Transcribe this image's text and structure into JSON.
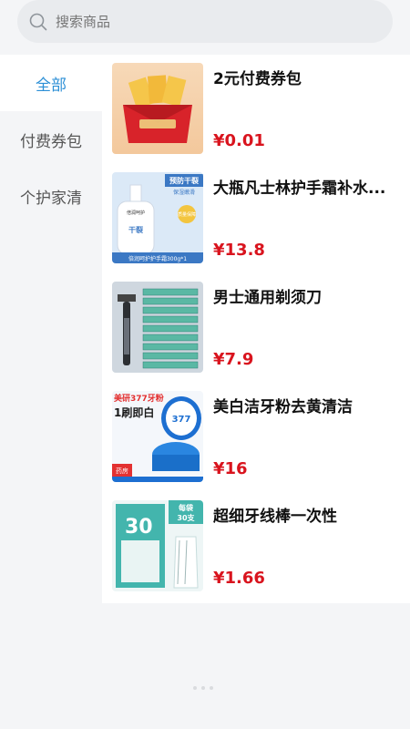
{
  "search": {
    "placeholder": "搜索商品"
  },
  "sidebar": {
    "items": [
      {
        "label": "全部",
        "active": true
      },
      {
        "label": "付费券包",
        "active": false
      },
      {
        "label": "个护家清",
        "active": false
      }
    ]
  },
  "products": [
    {
      "name": "2元付费券包",
      "price": "¥0.01",
      "image": "coupon-pack-image"
    },
    {
      "name": "大瓶凡士林护手霜补水...",
      "price": "¥13.8",
      "image": "hand-cream-image",
      "image_text": {
        "top": "预防干裂",
        "sub": "保湿嫩滑",
        "badge": "质量保障",
        "brand": "倍润呵护",
        "tag": "干裂",
        "caption": "倍润呵护护手霜300g*1"
      }
    },
    {
      "name": "男士通用剃须刀",
      "price": "¥7.9",
      "image": "razor-image"
    },
    {
      "name": "美白洁牙粉去黄清洁",
      "price": "¥16",
      "image": "tooth-powder-image",
      "image_text": {
        "headline": "美研377牙粉",
        "slogan": "1刷即白",
        "label_377": "377",
        "corner": "药房"
      }
    },
    {
      "name": "超细牙线棒一次性",
      "price": "¥1.66",
      "image": "floss-image",
      "image_text": {
        "big": "30",
        "bag": "每袋",
        "count": "30支"
      }
    }
  ],
  "colors": {
    "accent": "#2c8fd6",
    "price": "#d9141e"
  }
}
